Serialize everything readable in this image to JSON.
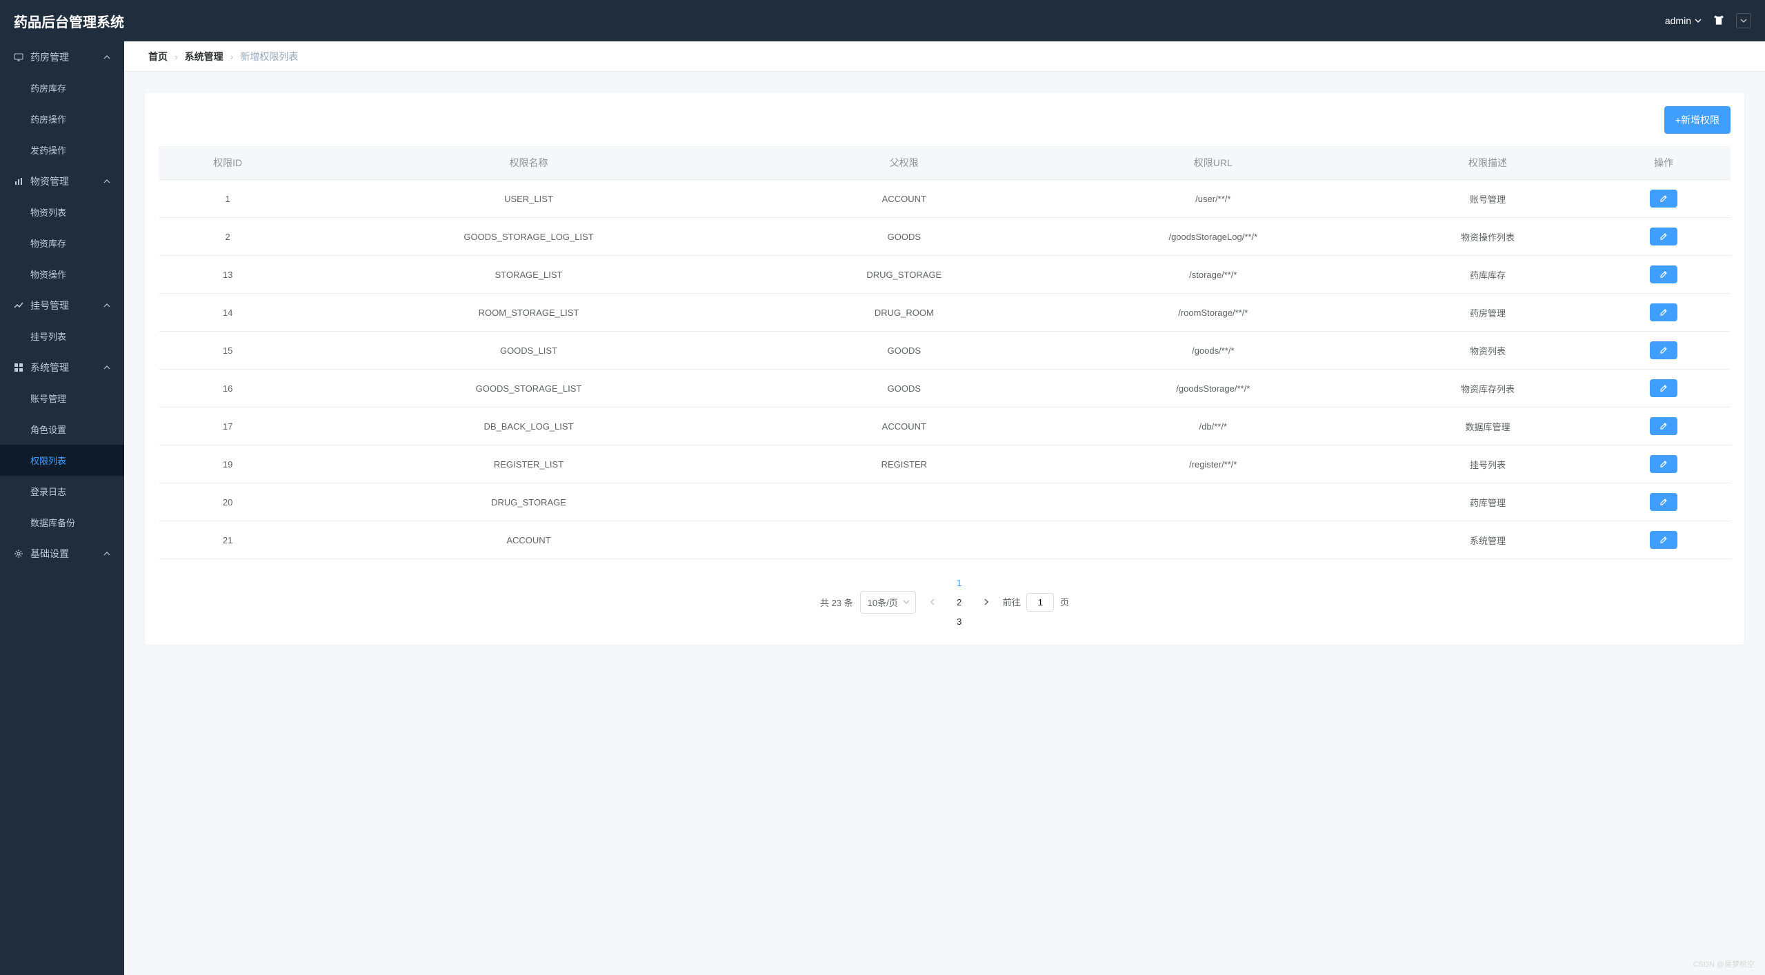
{
  "app": {
    "title": "药品后台管理系统"
  },
  "header": {
    "user": "admin"
  },
  "sidebar": {
    "groups": [
      {
        "label": "药房管理",
        "icon": "monitor",
        "items": [
          "药房库存",
          "药房操作",
          "发药操作"
        ]
      },
      {
        "label": "物资管理",
        "icon": "chart",
        "items": [
          "物资列表",
          "物资库存",
          "物资操作"
        ]
      },
      {
        "label": "挂号管理",
        "icon": "trend",
        "items": [
          "挂号列表"
        ]
      },
      {
        "label": "系统管理",
        "icon": "grid",
        "items": [
          "账号管理",
          "角色设置",
          "权限列表",
          "登录日志",
          "数据库备份"
        ],
        "activeIndex": 2
      },
      {
        "label": "基础设置",
        "icon": "gear",
        "items": []
      }
    ]
  },
  "breadcrumb": {
    "home": "首页",
    "section": "系统管理",
    "page": "新增权限列表"
  },
  "toolbar": {
    "add_label": "+新增权限"
  },
  "table": {
    "columns": [
      "权限ID",
      "权限名称",
      "父权限",
      "权限URL",
      "权限描述",
      "操作"
    ],
    "rows": [
      {
        "id": "1",
        "name": "USER_LIST",
        "parent": "ACCOUNT",
        "url": "/user/**/*",
        "desc": "账号管理"
      },
      {
        "id": "2",
        "name": "GOODS_STORAGE_LOG_LIST",
        "parent": "GOODS",
        "url": "/goodsStorageLog/**/*",
        "desc": "物资操作列表"
      },
      {
        "id": "13",
        "name": "STORAGE_LIST",
        "parent": "DRUG_STORAGE",
        "url": "/storage/**/*",
        "desc": "药库库存"
      },
      {
        "id": "14",
        "name": "ROOM_STORAGE_LIST",
        "parent": "DRUG_ROOM",
        "url": "/roomStorage/**/*",
        "desc": "药房管理"
      },
      {
        "id": "15",
        "name": "GOODS_LIST",
        "parent": "GOODS",
        "url": "/goods/**/*",
        "desc": "物资列表"
      },
      {
        "id": "16",
        "name": "GOODS_STORAGE_LIST",
        "parent": "GOODS",
        "url": "/goodsStorage/**/*",
        "desc": "物资库存列表"
      },
      {
        "id": "17",
        "name": "DB_BACK_LOG_LIST",
        "parent": "ACCOUNT",
        "url": "/db/**/*",
        "desc": "数据库管理"
      },
      {
        "id": "19",
        "name": "REGISTER_LIST",
        "parent": "REGISTER",
        "url": "/register/**/*",
        "desc": "挂号列表"
      },
      {
        "id": "20",
        "name": "DRUG_STORAGE",
        "parent": "",
        "url": "",
        "desc": "药库管理"
      },
      {
        "id": "21",
        "name": "ACCOUNT",
        "parent": "",
        "url": "",
        "desc": "系统管理"
      }
    ]
  },
  "pagination": {
    "total_label": "共 23 条",
    "size_label": "10条/页",
    "pages": [
      "1",
      "2",
      "3"
    ],
    "active": 0,
    "goto_prefix": "前往",
    "goto_value": "1",
    "goto_suffix": "页"
  },
  "watermark": "CSDN @是梦桃空"
}
